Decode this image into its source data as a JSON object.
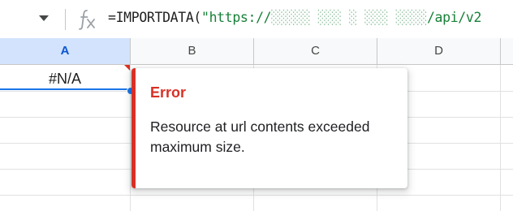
{
  "formula_bar": {
    "dropdown_icon": "caret-down-icon",
    "fx_icon": "function-fx-icon",
    "formula_prefix": "=IMPORTDATA(",
    "formula_string": "\"https://",
    "formula_redacted": "░░░░░ ░░░ ░ ░░░ ░░░░",
    "formula_suffix": "/api/v2"
  },
  "columns": [
    {
      "label": "A",
      "selected": true
    },
    {
      "label": "B",
      "selected": false
    },
    {
      "label": "C",
      "selected": false
    },
    {
      "label": "D",
      "selected": false
    }
  ],
  "cells": {
    "a1": "#N/A"
  },
  "error_popup": {
    "title": "Error",
    "message": "Resource at url contents exceeded maximum size.",
    "accent_color": "#d93025"
  },
  "colors": {
    "selection": "#1a73e8",
    "selected_header_bg": "#d3e3fd",
    "formula_string": "#188038"
  }
}
